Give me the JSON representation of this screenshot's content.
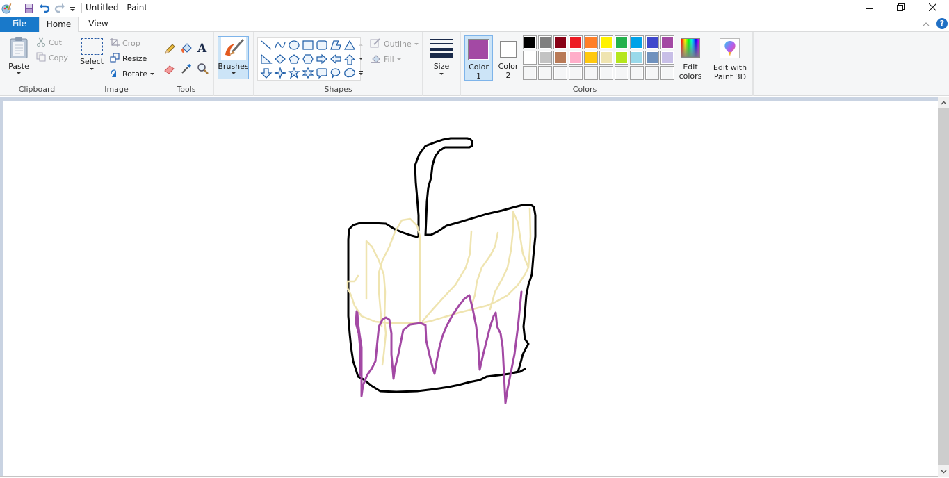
{
  "window": {
    "title": "Untitled - Paint",
    "controls": [
      "minimize",
      "restore",
      "close"
    ]
  },
  "quick_access": {
    "icons": [
      "paint-app-icon",
      "save-icon",
      "undo-icon",
      "redo-icon",
      "customize-qat-icon"
    ]
  },
  "tabs": [
    {
      "label": "File",
      "active": false
    },
    {
      "label": "Home",
      "active": true
    },
    {
      "label": "View",
      "active": false
    }
  ],
  "ribbon": {
    "clipboard": {
      "label": "Clipboard",
      "paste": "Paste",
      "cut": "Cut",
      "copy": "Copy"
    },
    "image": {
      "label": "Image",
      "select": "Select",
      "crop": "Crop",
      "resize": "Resize",
      "rotate": "Rotate"
    },
    "tools": {
      "label": "Tools",
      "items": [
        "pencil",
        "fill",
        "text",
        "eraser",
        "color-picker",
        "magnifier"
      ]
    },
    "brushes": {
      "label": "Brushes"
    },
    "shapes": {
      "label": "Shapes",
      "outline": "Outline",
      "fill": "Fill",
      "items": [
        "line",
        "curve",
        "oval",
        "rectangle",
        "rounded-rectangle",
        "polygon",
        "triangle",
        "right-triangle",
        "diamond",
        "pentagon",
        "hexagon",
        "right-arrow",
        "left-arrow",
        "up-arrow",
        "down-arrow",
        "four-point-star",
        "five-point-star",
        "six-point-star",
        "rounded-callout",
        "oval-callout",
        "cloud-callout"
      ]
    },
    "size": {
      "label": "Size"
    },
    "colors": {
      "label": "Colors",
      "color1_label": "Color",
      "color1_num": "1",
      "color2_label": "Color",
      "color2_num": "2",
      "color1": "#a349a4",
      "color2": "#ffffff",
      "palette_row1": [
        "#000000",
        "#7f7f7f",
        "#880015",
        "#ed1c24",
        "#ff7f27",
        "#fff200",
        "#22b14c",
        "#00a2e8",
        "#3f48cc",
        "#a349a4"
      ],
      "palette_row2": [
        "#ffffff",
        "#c3c3c3",
        "#b97a57",
        "#ffaec9",
        "#ffc90e",
        "#efe4b0",
        "#b5e61d",
        "#99d9ea",
        "#7092be",
        "#c8bfe7"
      ],
      "palette_row3": [
        "",
        "",
        "",
        "",
        "",
        "",
        "",
        "",
        "",
        ""
      ],
      "edit_colors_1": "Edit",
      "edit_colors_2": "colors"
    },
    "paint3d": {
      "line1": "Edit with",
      "line2": "Paint 3D"
    }
  },
  "drawing": {
    "stroke_colors": {
      "outline": "#000000",
      "sketch": "#efe4b0",
      "drips": "#a349a4"
    }
  }
}
